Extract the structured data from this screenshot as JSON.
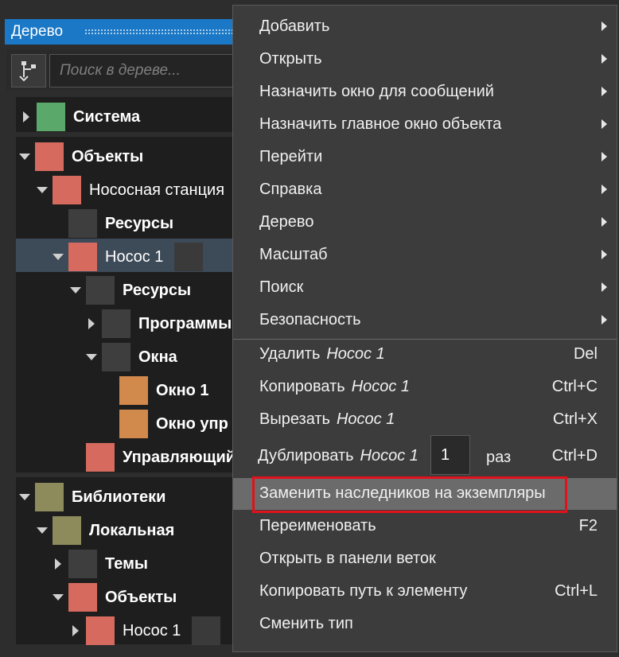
{
  "panel": {
    "title": "Дерево",
    "search_placeholder": "Поиск в дереве..."
  },
  "tree": {
    "system": "Система",
    "objects": "Объекты",
    "station": "Нососная станция",
    "resources1": "Ресурсы",
    "pump1": "Нococ 1",
    "resources2": "Ресурсы",
    "programs": "Программы",
    "windows": "Окна",
    "window1": "Окно 1",
    "window_ctrl": "Окно упр",
    "controller": "Управляющий",
    "libraries": "Библиотеки",
    "local": "Локальная",
    "themes": "Темы",
    "lib_objects": "Объекты",
    "lib_pump": "Нococ 1"
  },
  "menu": {
    "add": "Добавить",
    "open": "Открыть",
    "assign_msg": "Назначить окно для сообщений",
    "assign_main": "Назначить главное окно объекта",
    "goto": "Перейти",
    "help": "Справка",
    "tree": "Дерево",
    "scale": "Масштаб",
    "search": "Поиск",
    "security": "Безопасность",
    "delete": "Удалить",
    "delete_target": "Нococ 1",
    "delete_sc": "Del",
    "copy": "Копировать",
    "copy_target": "Нococ 1",
    "copy_sc": "Ctrl+C",
    "cut": "Вырезать",
    "cut_target": "Нococ 1",
    "cut_sc": "Ctrl+X",
    "duplicate": "Дублировать",
    "duplicate_target": "Нococ 1",
    "duplicate_count": "1",
    "duplicate_times": "раз",
    "duplicate_sc": "Ctrl+D",
    "replace_heirs": "Заменить наследников на экземпляры",
    "rename": "Переименовать",
    "rename_sc": "F2",
    "open_branches": "Открыть в панели веток",
    "copy_path": "Копировать путь к элементу",
    "copy_path_sc": "Ctrl+L",
    "change_type": "Сменить тип"
  },
  "colors": {
    "highlight_border": "#e0121b",
    "title_bar": "#1a78c6"
  }
}
